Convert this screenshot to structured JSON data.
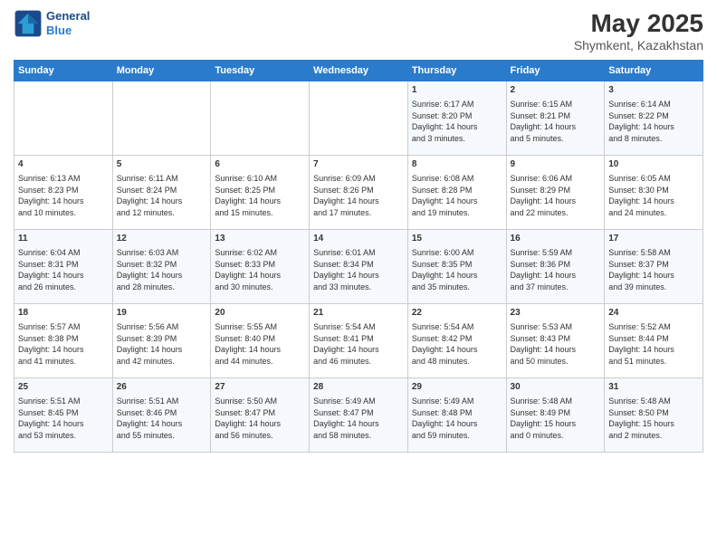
{
  "header": {
    "logo_line1": "General",
    "logo_line2": "Blue",
    "title": "May 2025",
    "subtitle": "Shymkent, Kazakhstan"
  },
  "days_of_week": [
    "Sunday",
    "Monday",
    "Tuesday",
    "Wednesday",
    "Thursday",
    "Friday",
    "Saturday"
  ],
  "weeks": [
    [
      {
        "day": "",
        "info": ""
      },
      {
        "day": "",
        "info": ""
      },
      {
        "day": "",
        "info": ""
      },
      {
        "day": "",
        "info": ""
      },
      {
        "day": "1",
        "info": "Sunrise: 6:17 AM\nSunset: 8:20 PM\nDaylight: 14 hours\nand 3 minutes."
      },
      {
        "day": "2",
        "info": "Sunrise: 6:15 AM\nSunset: 8:21 PM\nDaylight: 14 hours\nand 5 minutes."
      },
      {
        "day": "3",
        "info": "Sunrise: 6:14 AM\nSunset: 8:22 PM\nDaylight: 14 hours\nand 8 minutes."
      }
    ],
    [
      {
        "day": "4",
        "info": "Sunrise: 6:13 AM\nSunset: 8:23 PM\nDaylight: 14 hours\nand 10 minutes."
      },
      {
        "day": "5",
        "info": "Sunrise: 6:11 AM\nSunset: 8:24 PM\nDaylight: 14 hours\nand 12 minutes."
      },
      {
        "day": "6",
        "info": "Sunrise: 6:10 AM\nSunset: 8:25 PM\nDaylight: 14 hours\nand 15 minutes."
      },
      {
        "day": "7",
        "info": "Sunrise: 6:09 AM\nSunset: 8:26 PM\nDaylight: 14 hours\nand 17 minutes."
      },
      {
        "day": "8",
        "info": "Sunrise: 6:08 AM\nSunset: 8:28 PM\nDaylight: 14 hours\nand 19 minutes."
      },
      {
        "day": "9",
        "info": "Sunrise: 6:06 AM\nSunset: 8:29 PM\nDaylight: 14 hours\nand 22 minutes."
      },
      {
        "day": "10",
        "info": "Sunrise: 6:05 AM\nSunset: 8:30 PM\nDaylight: 14 hours\nand 24 minutes."
      }
    ],
    [
      {
        "day": "11",
        "info": "Sunrise: 6:04 AM\nSunset: 8:31 PM\nDaylight: 14 hours\nand 26 minutes."
      },
      {
        "day": "12",
        "info": "Sunrise: 6:03 AM\nSunset: 8:32 PM\nDaylight: 14 hours\nand 28 minutes."
      },
      {
        "day": "13",
        "info": "Sunrise: 6:02 AM\nSunset: 8:33 PM\nDaylight: 14 hours\nand 30 minutes."
      },
      {
        "day": "14",
        "info": "Sunrise: 6:01 AM\nSunset: 8:34 PM\nDaylight: 14 hours\nand 33 minutes."
      },
      {
        "day": "15",
        "info": "Sunrise: 6:00 AM\nSunset: 8:35 PM\nDaylight: 14 hours\nand 35 minutes."
      },
      {
        "day": "16",
        "info": "Sunrise: 5:59 AM\nSunset: 8:36 PM\nDaylight: 14 hours\nand 37 minutes."
      },
      {
        "day": "17",
        "info": "Sunrise: 5:58 AM\nSunset: 8:37 PM\nDaylight: 14 hours\nand 39 minutes."
      }
    ],
    [
      {
        "day": "18",
        "info": "Sunrise: 5:57 AM\nSunset: 8:38 PM\nDaylight: 14 hours\nand 41 minutes."
      },
      {
        "day": "19",
        "info": "Sunrise: 5:56 AM\nSunset: 8:39 PM\nDaylight: 14 hours\nand 42 minutes."
      },
      {
        "day": "20",
        "info": "Sunrise: 5:55 AM\nSunset: 8:40 PM\nDaylight: 14 hours\nand 44 minutes."
      },
      {
        "day": "21",
        "info": "Sunrise: 5:54 AM\nSunset: 8:41 PM\nDaylight: 14 hours\nand 46 minutes."
      },
      {
        "day": "22",
        "info": "Sunrise: 5:54 AM\nSunset: 8:42 PM\nDaylight: 14 hours\nand 48 minutes."
      },
      {
        "day": "23",
        "info": "Sunrise: 5:53 AM\nSunset: 8:43 PM\nDaylight: 14 hours\nand 50 minutes."
      },
      {
        "day": "24",
        "info": "Sunrise: 5:52 AM\nSunset: 8:44 PM\nDaylight: 14 hours\nand 51 minutes."
      }
    ],
    [
      {
        "day": "25",
        "info": "Sunrise: 5:51 AM\nSunset: 8:45 PM\nDaylight: 14 hours\nand 53 minutes."
      },
      {
        "day": "26",
        "info": "Sunrise: 5:51 AM\nSunset: 8:46 PM\nDaylight: 14 hours\nand 55 minutes."
      },
      {
        "day": "27",
        "info": "Sunrise: 5:50 AM\nSunset: 8:47 PM\nDaylight: 14 hours\nand 56 minutes."
      },
      {
        "day": "28",
        "info": "Sunrise: 5:49 AM\nSunset: 8:47 PM\nDaylight: 14 hours\nand 58 minutes."
      },
      {
        "day": "29",
        "info": "Sunrise: 5:49 AM\nSunset: 8:48 PM\nDaylight: 14 hours\nand 59 minutes."
      },
      {
        "day": "30",
        "info": "Sunrise: 5:48 AM\nSunset: 8:49 PM\nDaylight: 15 hours\nand 0 minutes."
      },
      {
        "day": "31",
        "info": "Sunrise: 5:48 AM\nSunset: 8:50 PM\nDaylight: 15 hours\nand 2 minutes."
      }
    ]
  ]
}
